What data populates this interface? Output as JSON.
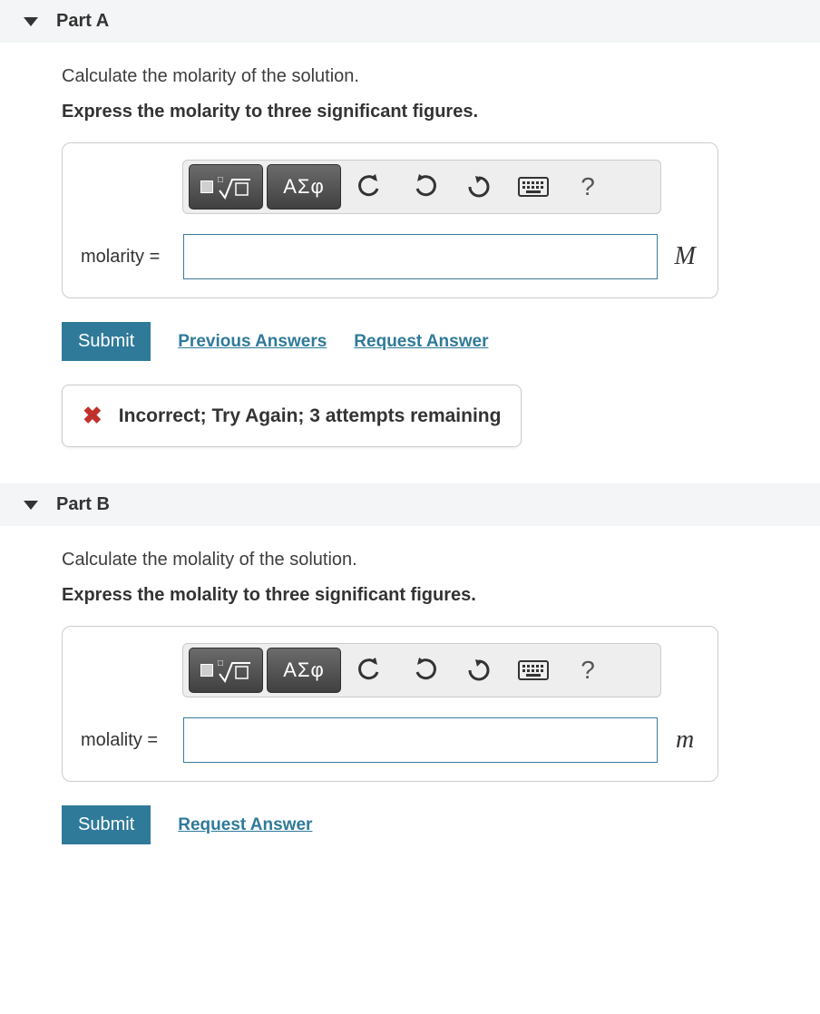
{
  "parts": [
    {
      "title": "Part A",
      "prompt": "Calculate the molarity of the solution.",
      "instruction": "Express the molarity to three significant figures.",
      "label": "molarity =",
      "input_value": "",
      "unit": "M",
      "toolbar": {
        "greek": "ΑΣφ",
        "help": "?"
      },
      "submit": "Submit",
      "links": [
        "Previous Answers",
        "Request Answer"
      ],
      "feedback": "Incorrect; Try Again; 3 attempts remaining"
    },
    {
      "title": "Part B",
      "prompt": "Calculate the molality of the solution.",
      "instruction": "Express the molality to three significant figures.",
      "label": "molality =",
      "input_value": "",
      "unit": "m",
      "toolbar": {
        "greek": "ΑΣφ",
        "help": "?"
      },
      "submit": "Submit",
      "links": [
        "Request Answer"
      ],
      "feedback": null
    }
  ]
}
